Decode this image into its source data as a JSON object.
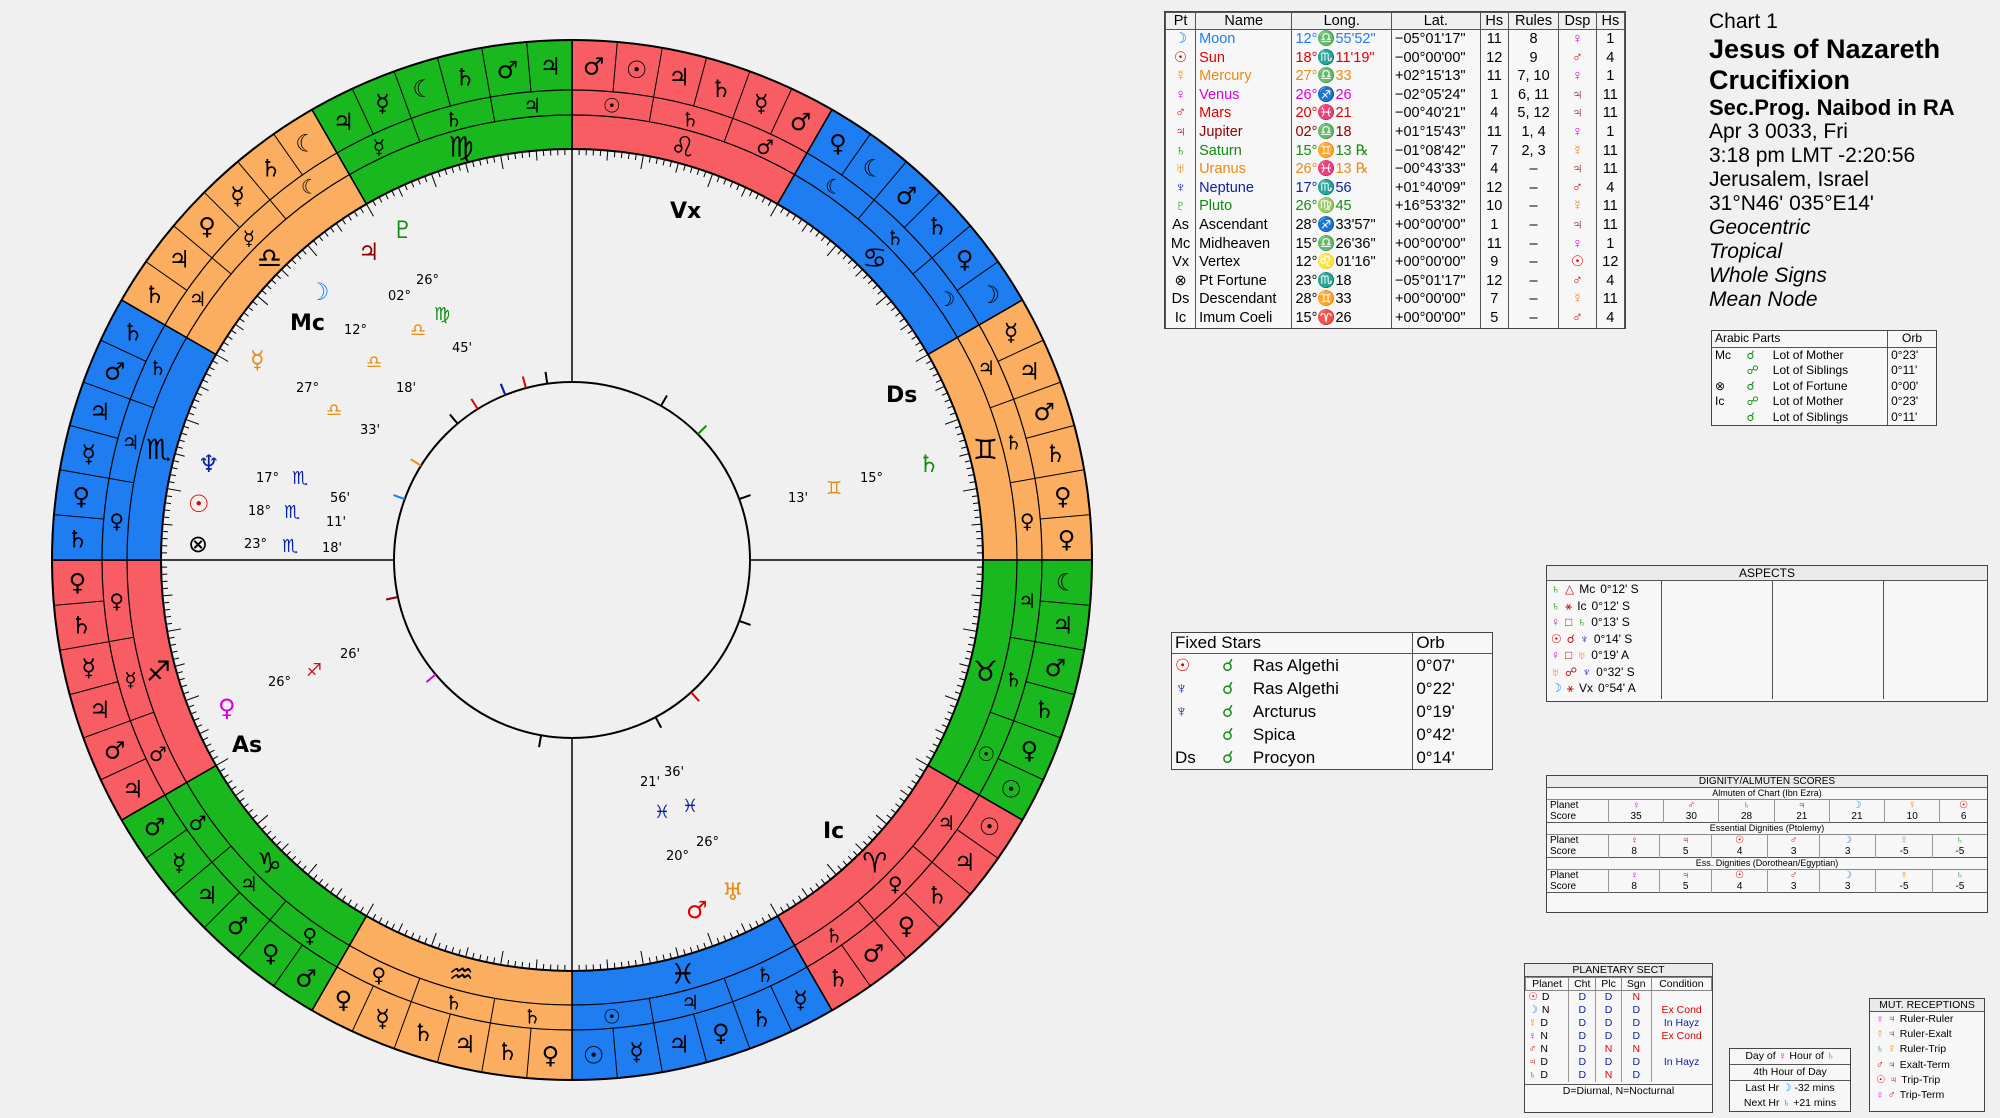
{
  "colors": {
    "fire": "#f75d62",
    "earth": "#19b81f",
    "air": "#fcae60",
    "water": "#1e7df0"
  },
  "signs": [
    "♈",
    "♉",
    "♊",
    "♋",
    "♌",
    "♍",
    "♎",
    "♏",
    "♐",
    "♑",
    "♒",
    "♓"
  ],
  "ring_outer_rows": [
    [
      "♂",
      "☉",
      "♃",
      "♄",
      "☿",
      "♂"
    ],
    [
      "♀",
      "☾",
      "♂",
      "♄",
      "♀",
      "☽"
    ],
    [
      "☿",
      "♃",
      "♂",
      "♄",
      "♀",
      "♀"
    ],
    [
      "☾",
      "♃",
      "♂",
      "♄",
      "♀",
      "☉"
    ],
    [
      "☉",
      "♃",
      "♄",
      "♀",
      "♂",
      "♄"
    ],
    [
      "☿",
      "♄",
      "♀",
      "♃",
      "☿",
      "☉"
    ],
    [
      "♀",
      "♄",
      "♃",
      "♄",
      "☿",
      "♀"
    ],
    [
      "♂",
      "♀",
      "♂",
      "♃",
      "☿",
      "♂"
    ],
    [
      "♃",
      "♂",
      "♃",
      "☿",
      "♄",
      "♀"
    ],
    [
      "♄",
      "♀",
      "☿",
      "♃",
      "♂",
      "♄"
    ],
    [
      "♄",
      "♃",
      "♀",
      "☿",
      "♄",
      "☾"
    ],
    [
      "♃",
      "☿",
      "☾",
      "♄",
      "♂",
      "♃"
    ]
  ],
  "cusp_labels": {
    "mc": "Mc",
    "ic": "Ic",
    "as": "As",
    "ds": "Ds",
    "vx": "Vx"
  },
  "wheel_glyphs": [
    {
      "g": "♆",
      "lon": "17°",
      "min": "56'",
      "s": "♏",
      "c": "#0b1fa2"
    },
    {
      "g": "☉",
      "lon": "18°",
      "min": "11'",
      "s": "♏",
      "c": "#e00000"
    },
    {
      "g": "⊗",
      "lon": "23°",
      "min": "18'",
      "s": "♏",
      "c": "#000"
    },
    {
      "g": "☽",
      "lon": "12°",
      "min": "",
      "s": "♎",
      "c": "#1e7df0"
    },
    {
      "g": "☿",
      "lon": "27°",
      "min": "33'",
      "s": "♎",
      "c": "#e98a14"
    },
    {
      "g": "♀",
      "lon": "26°",
      "min": "26'",
      "s": "♐",
      "c": "#d900d9"
    },
    {
      "g": "♂",
      "lon": "20°",
      "min": "21'",
      "s": "♓",
      "c": "#e00000"
    },
    {
      "g": "♅",
      "lon": "26°",
      "min": "36'",
      "s": "♓",
      "c": "#e98a14"
    },
    {
      "g": "♄",
      "lon": "15°",
      "min": "13'",
      "s": "♊",
      "c": "#118c11"
    },
    {
      "g": "♇",
      "lon": "26°",
      "min": "45'",
      "s": "♍",
      "c": "#118c11"
    },
    {
      "g": "♃",
      "lon": "02°",
      "min": "18'",
      "s": "♎",
      "c": "#8b0000"
    }
  ],
  "planet_table": {
    "headers": [
      "Pt",
      "Name",
      "Long.",
      "Lat.",
      "Hs",
      "Rules",
      "Dsp",
      "Hs"
    ],
    "rows": [
      {
        "pt": "☽",
        "name": "Moon",
        "c": "#1e7df0",
        "long": "12°♎55'52\"",
        "lat": "−05°01'17\"",
        "hs": "11",
        "rules": "8",
        "dsp": "♀",
        "hs2": "1"
      },
      {
        "pt": "☉",
        "name": "Sun",
        "c": "#e00000",
        "long": "18°♏11'19\"",
        "lat": "−00°00'00\"",
        "hs": "12",
        "rules": "9",
        "dsp": "♂",
        "hs2": "4"
      },
      {
        "pt": "☿",
        "name": "Mercury",
        "c": "#e98a14",
        "long": "27°♎33",
        "lat": "+02°15'13\"",
        "hs": "11",
        "rules": "7, 10",
        "dsp": "♀",
        "hs2": "1"
      },
      {
        "pt": "♀",
        "name": "Venus",
        "c": "#d900d9",
        "long": "26°♐26",
        "lat": "−02°05'24\"",
        "hs": "1",
        "rules": "6, 11",
        "dsp": "♃",
        "hs2": "11"
      },
      {
        "pt": "♂",
        "name": "Mars",
        "c": "#e00000",
        "long": "20°♓21",
        "lat": "−00°40'21\"",
        "hs": "4",
        "rules": "5, 12",
        "dsp": "♃",
        "hs2": "11"
      },
      {
        "pt": "♃",
        "name": "Jupiter",
        "c": "#8b0000",
        "long": "02°♎18",
        "lat": "+01°15'43\"",
        "hs": "11",
        "rules": "1, 4",
        "dsp": "♀",
        "hs2": "1"
      },
      {
        "pt": "♄",
        "name": "Saturn",
        "c": "#118c11",
        "long": "15°♊13 ℞",
        "lat": "−01°08'42\"",
        "hs": "7",
        "rules": "2, 3",
        "dsp": "☿",
        "hs2": "11"
      },
      {
        "pt": "♅",
        "name": "Uranus",
        "c": "#e98a14",
        "long": "26°♓13 ℞",
        "lat": "−00°43'33\"",
        "hs": "4",
        "rules": "–",
        "dsp": "♃",
        "hs2": "11"
      },
      {
        "pt": "♆",
        "name": "Neptune",
        "c": "#0b1fa2",
        "long": "17°♏56",
        "lat": "+01°40'09\"",
        "hs": "12",
        "rules": "–",
        "dsp": "♂",
        "hs2": "4"
      },
      {
        "pt": "♇",
        "name": "Pluto",
        "c": "#118c11",
        "long": "26°♍45",
        "lat": "+16°53'32\"",
        "hs": "10",
        "rules": "–",
        "dsp": "☿",
        "hs2": "11"
      },
      {
        "pt": "As",
        "name": "Ascendant",
        "c": "#000",
        "long": "28°♐33'57\"",
        "lat": "+00°00'00\"",
        "hs": "1",
        "rules": "–",
        "dsp": "♃",
        "hs2": "11"
      },
      {
        "pt": "Mc",
        "name": "Midheaven",
        "c": "#000",
        "long": "15°♎26'36\"",
        "lat": "+00°00'00\"",
        "hs": "11",
        "rules": "–",
        "dsp": "♀",
        "hs2": "1"
      },
      {
        "pt": "Vx",
        "name": "Vertex",
        "c": "#000",
        "long": "12°♌01'16\"",
        "lat": "+00°00'00\"",
        "hs": "9",
        "rules": "–",
        "dsp": "☉",
        "hs2": "12"
      },
      {
        "pt": "⊗",
        "name": "Pt Fortune",
        "c": "#000",
        "long": "23°♏18",
        "lat": "−05°01'17\"",
        "hs": "12",
        "rules": "–",
        "dsp": "♂",
        "hs2": "4"
      },
      {
        "pt": "Ds",
        "name": "Descendant",
        "c": "#000",
        "long": "28°♊33",
        "lat": "+00°00'00\"",
        "hs": "7",
        "rules": "–",
        "dsp": "☿",
        "hs2": "11"
      },
      {
        "pt": "Ic",
        "name": "Imum Coeli",
        "c": "#000",
        "long": "15°♈26",
        "lat": "+00°00'00\"",
        "hs": "5",
        "rules": "–",
        "dsp": "♂",
        "hs2": "4"
      }
    ]
  },
  "chart_info": {
    "label": "Chart 1",
    "title1": "Jesus of Nazareth",
    "title2": "Crucifixion",
    "type": "Sec.Prog. Naibod in RA",
    "date": "Apr 3 0033, Fri",
    "time": "3:18 pm  LMT -2:20:56",
    "place": "Jerusalem, Israel",
    "coords": "31°N46' 035°E14'",
    "s1": "Geocentric",
    "s2": "Tropical",
    "s3": "Whole Signs",
    "s4": "Mean Node"
  },
  "arabic_parts": {
    "title": "Arabic Parts",
    "orb": "Orb",
    "rows": [
      {
        "a": "Mc",
        "b": "☌",
        "name": "Lot of Mother",
        "orb": "0°23'"
      },
      {
        "a": "",
        "b": "☍",
        "name": "Lot of Siblings",
        "orb": "0°11'"
      },
      {
        "a": "⊗",
        "b": "☌",
        "name": "Lot of Fortune",
        "orb": "0°00'"
      },
      {
        "a": "Ic",
        "b": "☍",
        "name": "Lot of Mother",
        "orb": "0°23'"
      },
      {
        "a": "",
        "b": "☌",
        "name": "Lot of Siblings",
        "orb": "0°11'"
      }
    ]
  },
  "aspects": {
    "title": "ASPECTS",
    "rows": [
      {
        "p1": "♄",
        "asp": "△",
        "p2": "Mc",
        "orb": "0°12' S"
      },
      {
        "p1": "♄",
        "asp": "⚹",
        "p2": "Ic",
        "orb": "0°12' S"
      },
      {
        "p1": "♀",
        "asp": "□",
        "p2": "♄",
        "orb": "0°13' S"
      },
      {
        "p1": "☉",
        "asp": "☌",
        "p2": "♆",
        "orb": "0°14' S"
      },
      {
        "p1": "♀",
        "asp": "□",
        "p2": "♅",
        "orb": "0°19' A"
      },
      {
        "p1": "♅",
        "asp": "☍",
        "p2": "♆",
        "orb": "0°32' S"
      },
      {
        "p1": "☽",
        "asp": "⚹",
        "p2": "Vx",
        "orb": "0°54' A"
      }
    ]
  },
  "fixed_stars": {
    "h1": "Fixed Stars",
    "h2": "Orb",
    "rows": [
      {
        "p": "☉",
        "a": "☌",
        "star": "Ras Algethi",
        "orb": "0°07'"
      },
      {
        "p": "♆",
        "a": "☌",
        "star": "Ras Algethi",
        "orb": "0°22'"
      },
      {
        "p": "♆",
        "a": "☌",
        "star": "Arcturus",
        "orb": "0°19'"
      },
      {
        "p": "",
        "a": "☌",
        "star": "Spica",
        "orb": "0°42'"
      },
      {
        "p": "Ds",
        "a": "☌",
        "star": "Procyon",
        "orb": "0°14'"
      }
    ]
  },
  "dignity": {
    "title": "DIGNITY/ALMUTEN SCORES",
    "sections": [
      {
        "name": "Almuten of Chart (Ibn Ezra)",
        "planets": [
          "♀",
          "♂",
          "♄",
          "♃",
          "☽",
          "☿",
          "☉"
        ],
        "scores": [
          "35",
          "30",
          "28",
          "21",
          "21",
          "10",
          "6"
        ]
      },
      {
        "name": "Essential Dignities (Ptolemy)",
        "planets": [
          "♀",
          "♃",
          "☉",
          "♂",
          "☽",
          "☿",
          "♄"
        ],
        "scores": [
          "8",
          "5",
          "4",
          "3",
          "3",
          "-5",
          "-5"
        ]
      },
      {
        "name": "Ess. Dignities (Dorothean/Egyptian)",
        "planets": [
          "♀",
          "♃",
          "☉",
          "♂",
          "☽",
          "☿",
          "♄"
        ],
        "scores": [
          "8",
          "5",
          "4",
          "3",
          "3",
          "-5",
          "-5"
        ]
      }
    ],
    "planet_label": "Planet",
    "score_label": "Score"
  },
  "sect": {
    "title": "PLANETARY SECT",
    "headers": [
      "Planet",
      "Cht",
      "Plc",
      "Sgn",
      "Condition"
    ],
    "rows": [
      {
        "p": "☉",
        "s": "D",
        "cht": "D",
        "plc": "D",
        "sgn": "N",
        "cond": ""
      },
      {
        "p": "☽",
        "s": "N",
        "cht": "D",
        "plc": "D",
        "sgn": "D",
        "cond": "Ex Cond"
      },
      {
        "p": "☿",
        "s": "D",
        "cht": "D",
        "plc": "D",
        "sgn": "D",
        "cond": "In Hayz"
      },
      {
        "p": "♀",
        "s": "N",
        "cht": "D",
        "plc": "D",
        "sgn": "D",
        "cond": "Ex Cond"
      },
      {
        "p": "♂",
        "s": "N",
        "cht": "D",
        "plc": "N",
        "sgn": "N",
        "cond": ""
      },
      {
        "p": "♃",
        "s": "D",
        "cht": "D",
        "plc": "D",
        "sgn": "D",
        "cond": "In Hayz"
      },
      {
        "p": "♄",
        "s": "D",
        "cht": "D",
        "plc": "N",
        "sgn": "D",
        "cond": ""
      }
    ],
    "footer": "D=Diurnal, N=Nocturnal"
  },
  "hour": {
    "l1a": "Day of",
    "l1b": "♀",
    "l1c": "Hour of",
    "l1d": "♄",
    "l2": "4th Hour of Day",
    "l3a": "Last Hr",
    "l3b": "☽",
    "l3c": "-32 mins",
    "l4a": "Next Hr",
    "l4b": "♄",
    "l4c": "+21 mins"
  },
  "receptions": {
    "title": "MUT. RECEPTIONS",
    "rows": [
      {
        "a": "♀",
        "b": "♃",
        "t": "Ruler-Ruler"
      },
      {
        "a": "☿",
        "b": "♃",
        "t": "Ruler-Exalt"
      },
      {
        "a": "♄",
        "b": "☿",
        "t": "Ruler-Trip"
      },
      {
        "a": "♂",
        "b": "♃",
        "t": "Exalt-Term"
      },
      {
        "a": "☉",
        "b": "♃",
        "t": "Trip-Trip"
      },
      {
        "a": "♀",
        "b": "♂",
        "t": "Trip-Term"
      }
    ]
  }
}
